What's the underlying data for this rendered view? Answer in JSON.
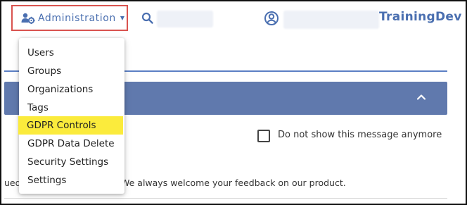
{
  "header": {
    "admin_label": "Administration",
    "org_name": "TrainingDev",
    "accent_color": "#4a6fb0",
    "highlight_border_color": "#d9534f"
  },
  "menu": {
    "items": [
      {
        "label": "Users"
      },
      {
        "label": "Groups"
      },
      {
        "label": "Organizations"
      },
      {
        "label": "Tags"
      },
      {
        "label": "GDPR Controls",
        "highlighted": true
      },
      {
        "label": "GDPR Data Delete"
      },
      {
        "label": "Security Settings"
      },
      {
        "label": "Settings"
      }
    ],
    "highlight_color": "#fbeb3c"
  },
  "content": {
    "panel_color": "#6079ad",
    "checkbox_label": "Do not show this message anymore",
    "checkbox_checked": false,
    "feedback_left": "ued",
    "feedback_right": "We always welcome your feedback on our product."
  },
  "icons": [
    "admin-gear-user-icon",
    "caret-down-icon",
    "search-icon",
    "user-circle-icon",
    "chevron-up-icon"
  ]
}
